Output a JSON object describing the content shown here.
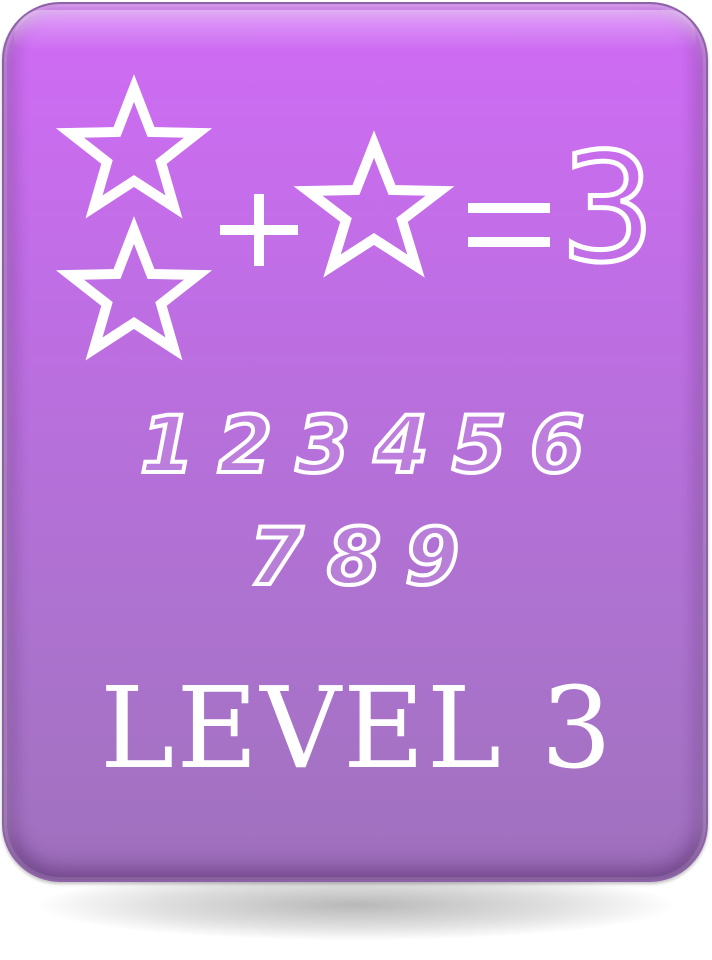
{
  "card": {
    "colors": {
      "top": "#d06cf5",
      "bottom": "#9f71bd",
      "chalk": "#ffffff"
    }
  },
  "equation": {
    "icons": [
      "star-outline-icon",
      "star-outline-icon",
      "star-outline-icon"
    ],
    "plus": "+",
    "equals": "=",
    "answer": "3"
  },
  "number_choices": {
    "row1": [
      "1",
      "2",
      "3",
      "4",
      "5",
      "6"
    ],
    "row2": [
      "7",
      "8",
      "9"
    ]
  },
  "level": {
    "title": "LEVEL 3"
  }
}
